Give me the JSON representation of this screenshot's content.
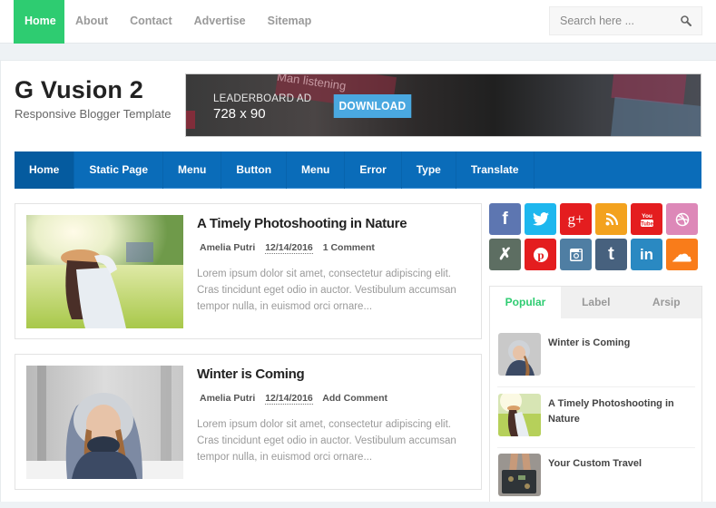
{
  "topnav": {
    "items": [
      {
        "label": "Home",
        "active": true
      },
      {
        "label": "About"
      },
      {
        "label": "Contact"
      },
      {
        "label": "Advertise"
      },
      {
        "label": "Sitemap"
      }
    ],
    "accent": "#2ecc71"
  },
  "search": {
    "placeholder": "Search here ...",
    "value": "",
    "icon": "search-icon"
  },
  "header": {
    "title": "G Vusion 2",
    "description": "Responsive Blogger Template"
  },
  "ad": {
    "label": "LEADERBOARD AD",
    "size": "728 x 90",
    "button": "DOWNLOAD",
    "bg_text": "Man listening"
  },
  "mainnav": {
    "color": "#0a6cb9",
    "items": [
      {
        "label": "Home",
        "active": true
      },
      {
        "label": "Static Page"
      },
      {
        "label": "Menu"
      },
      {
        "label": "Button"
      },
      {
        "label": "Menu"
      },
      {
        "label": "Error"
      },
      {
        "label": "Type"
      },
      {
        "label": "Translate"
      }
    ]
  },
  "posts": [
    {
      "title": "A Timely Photoshooting in Nature",
      "author": "Amelia Putri",
      "date": "12/14/2016",
      "comments": "1 Comment",
      "excerpt": "Lorem ipsum dolor sit amet, consectetur adipiscing elit. Cras tincidunt eget odio in auctor. Vestibulum accumsan tempor nulla, in euismod orci ornare...",
      "image": "woman-in-meadow-photo"
    },
    {
      "title": "Winter is Coming",
      "author": "Amelia Putri",
      "date": "12/14/2016",
      "comments": "Add Comment",
      "excerpt": "Lorem ipsum dolor sit amet, consectetur adipiscing elit. Cras tincidunt eget odio in auctor. Vestibulum accumsan tempor nulla, in euismod orci ornare...",
      "image": "woman-in-snow-photo"
    }
  ],
  "social": [
    {
      "name": "facebook",
      "glyph": "f",
      "color": "#5d76b1"
    },
    {
      "name": "twitter",
      "glyph": "🐦",
      "color": "#1eb7ee"
    },
    {
      "name": "google-plus",
      "glyph": "g+",
      "color": "#e41d1f"
    },
    {
      "name": "rss",
      "glyph": "◥",
      "color": "#f3a21e"
    },
    {
      "name": "youtube",
      "glyph": "▶",
      "color": "#e41d1f"
    },
    {
      "name": "dribbble",
      "glyph": "◎",
      "color": "#dd88b8"
    },
    {
      "name": "deviantart",
      "glyph": "✗",
      "color": "#5d6e62"
    },
    {
      "name": "pinterest",
      "glyph": "P",
      "color": "#e41d1f"
    },
    {
      "name": "instagram",
      "glyph": "◙",
      "color": "#4f7ea3"
    },
    {
      "name": "tumblr",
      "glyph": "t",
      "color": "#47617e"
    },
    {
      "name": "linkedin",
      "glyph": "in",
      "color": "#2a89c2"
    },
    {
      "name": "soundcloud",
      "glyph": "☁",
      "color": "#f97c1a"
    }
  ],
  "sidebar_tabs": {
    "tabs": [
      {
        "label": "Popular",
        "active": true
      },
      {
        "label": "Label"
      },
      {
        "label": "Arsip"
      }
    ],
    "items": [
      {
        "title": "Winter is Coming"
      },
      {
        "title": "A Timely Photoshooting in Nature"
      },
      {
        "title": "Your Custom Travel"
      }
    ]
  }
}
